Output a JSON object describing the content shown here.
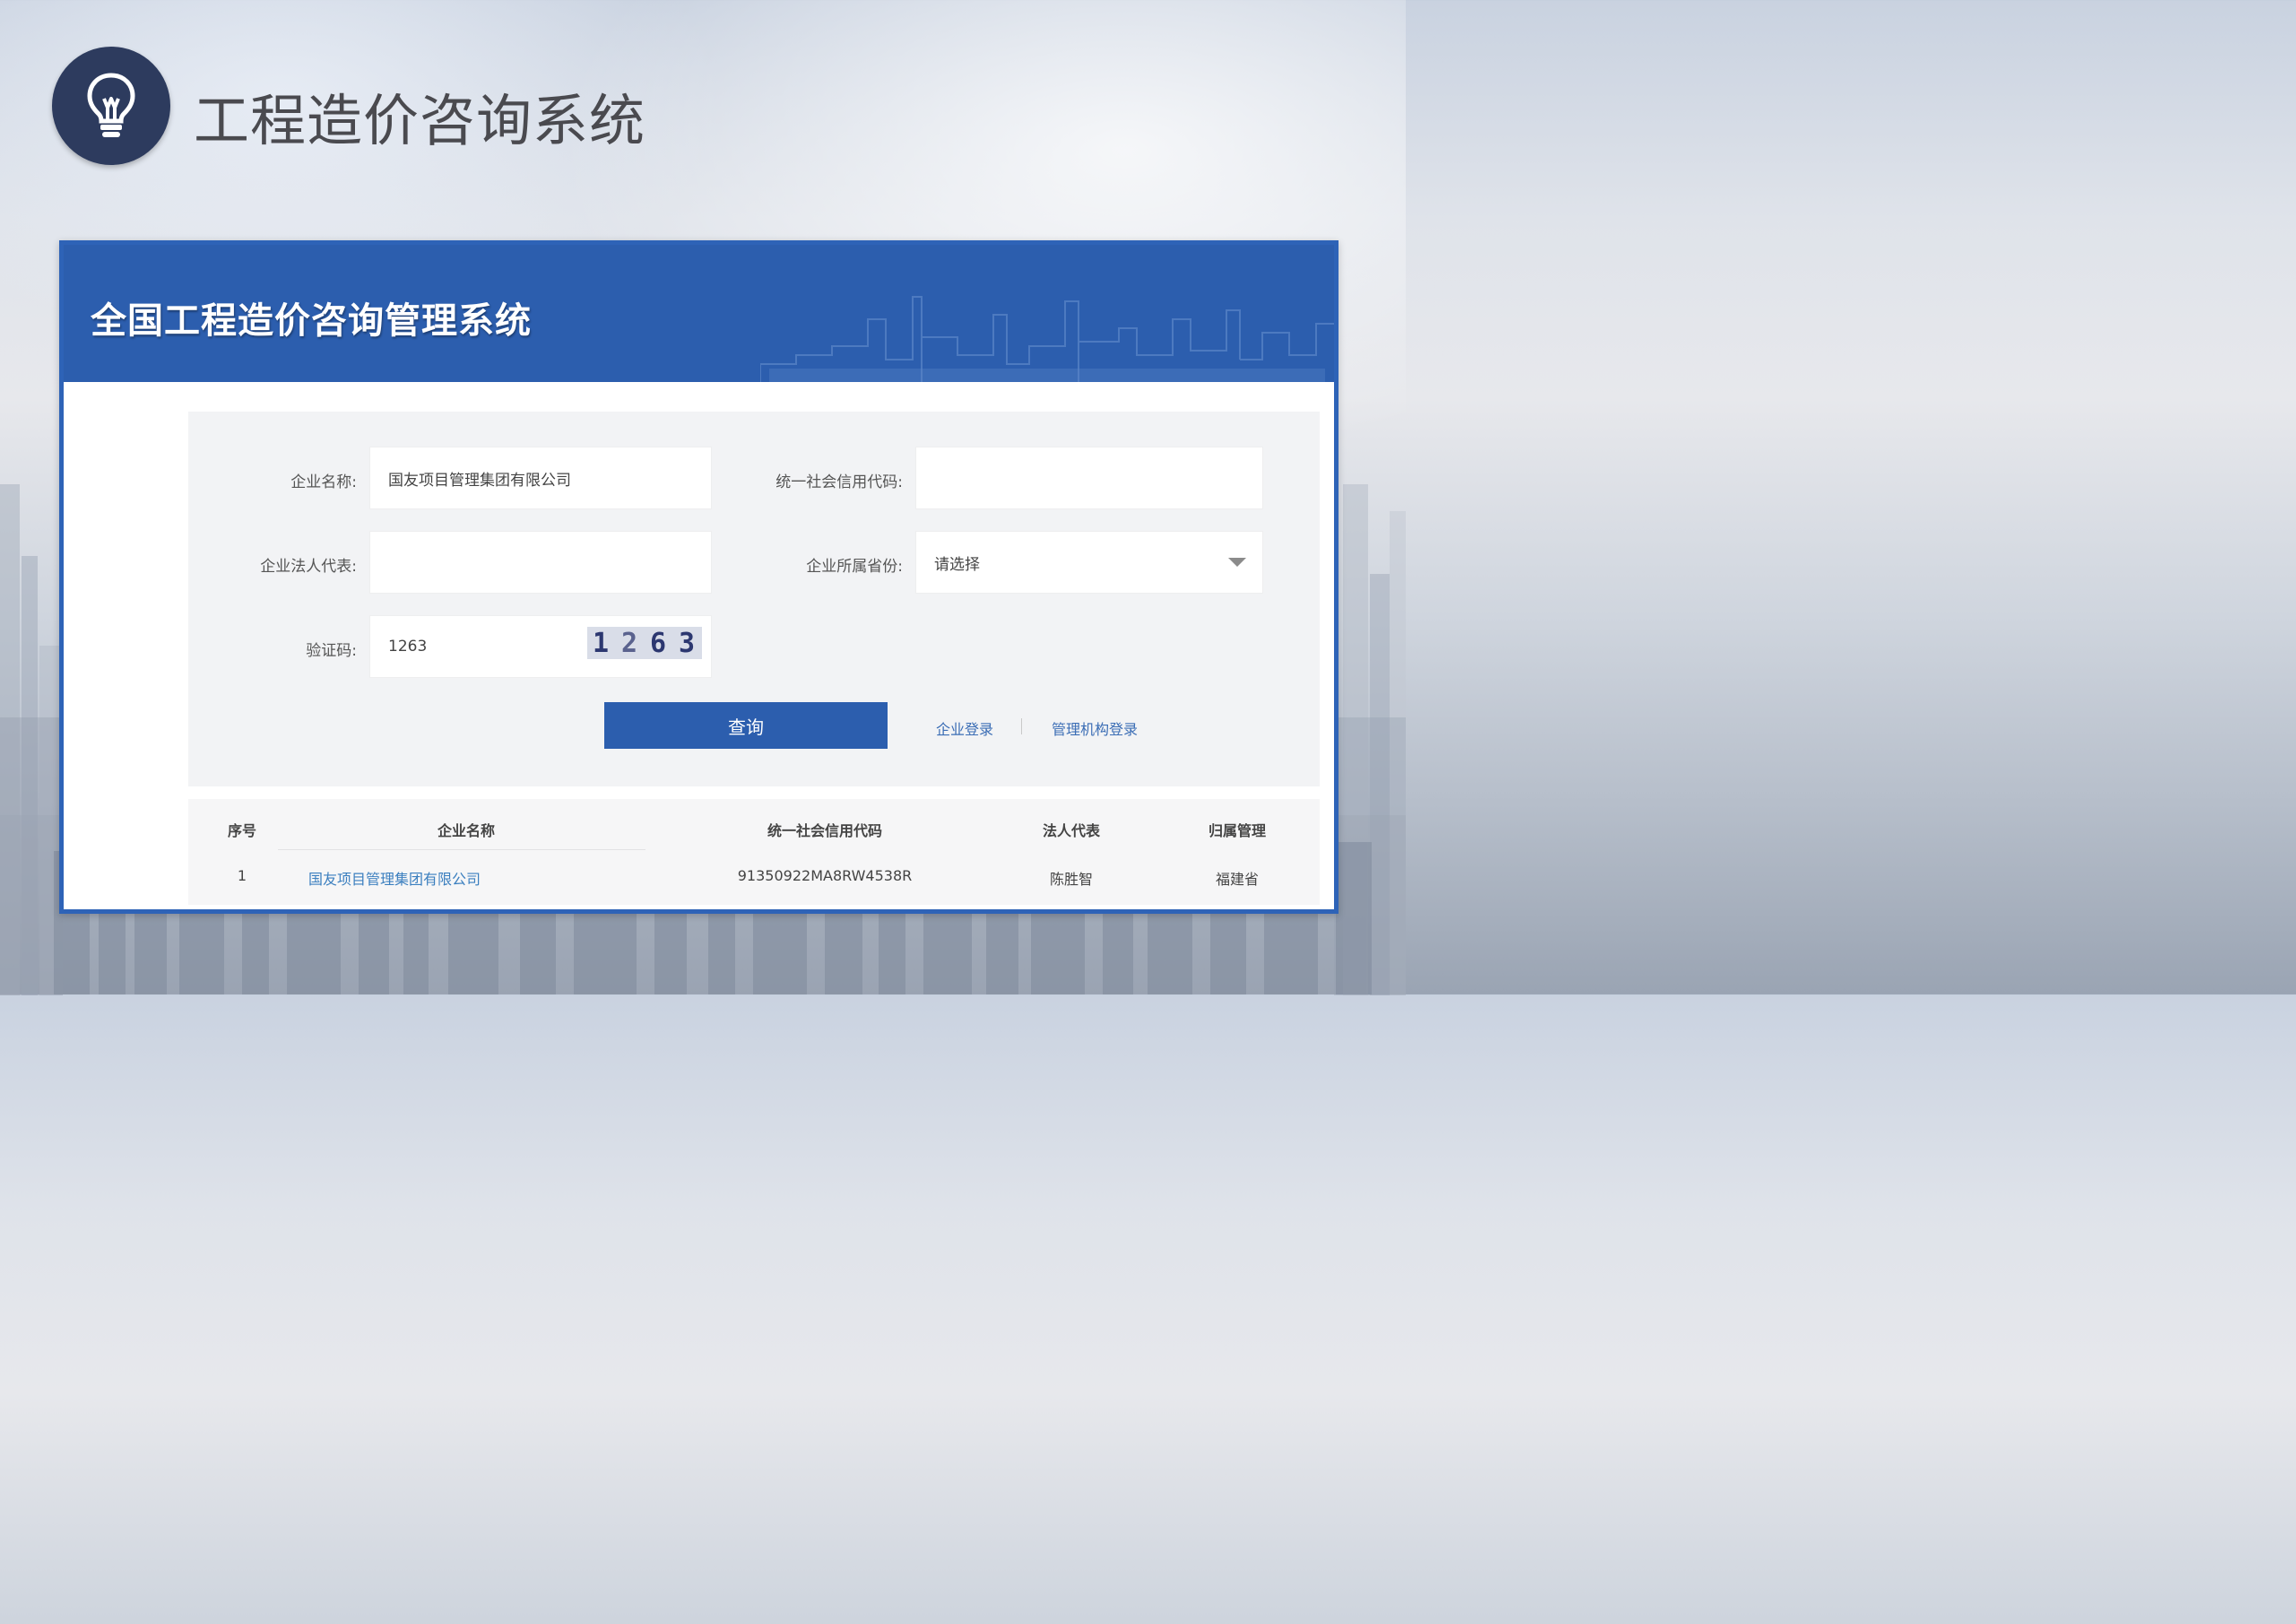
{
  "page": {
    "heading": "工程造价咨询系统",
    "bulb_icon": "lightbulb-icon"
  },
  "app": {
    "system_title": "全国工程造价咨询管理系统"
  },
  "form": {
    "company_name_label": "企业名称:",
    "company_name_value": "国友项目管理集团有限公司",
    "credit_code_label": "统一社会信用代码:",
    "credit_code_value": "",
    "legal_rep_label": "企业法人代表:",
    "legal_rep_value": "",
    "province_label": "企业所属省份:",
    "province_value": "请选择",
    "captcha_label": "验证码:",
    "captcha_value": "1263",
    "captcha_image_text": [
      "1",
      "2",
      "6",
      "3"
    ],
    "query_button": "查询",
    "company_login_link": "企业登录",
    "admin_login_link": "管理机构登录"
  },
  "table": {
    "headers": [
      "序号",
      "企业名称",
      "统一社会信用代码",
      "法人代表",
      "归属管理"
    ],
    "rows": [
      [
        "1",
        "国友项目管理集团有限公司",
        "91350922MA8RW4538R",
        "陈胜智",
        "福建省"
      ]
    ]
  },
  "colors": {
    "banner_blue": "#2c5eae",
    "heading_circle": "#2d3b5e",
    "link_blue": "#3b6db5"
  }
}
